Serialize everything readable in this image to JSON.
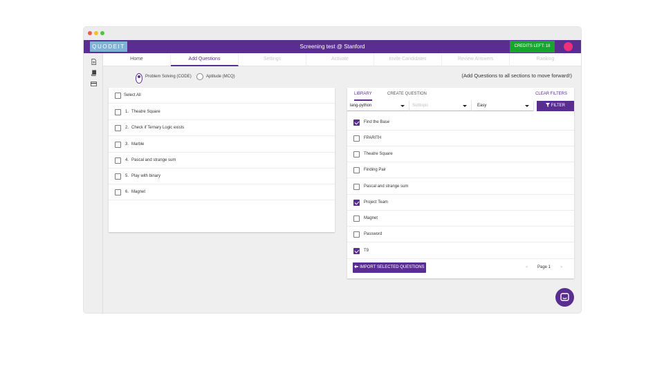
{
  "window": {
    "title": "Screening test @ Stanford"
  },
  "brand": {
    "logo_text": "QUODEIT"
  },
  "header": {
    "credits": "CREDITS LEFT: 18"
  },
  "sidebar": {
    "icons": [
      "document-icon",
      "book-icon",
      "card-icon"
    ]
  },
  "nav": {
    "tabs": [
      {
        "label": "Home",
        "state": "done"
      },
      {
        "label": "Add Questions",
        "state": "active"
      },
      {
        "label": "Settings",
        "state": "disabled"
      },
      {
        "label": "Activate",
        "state": "disabled"
      },
      {
        "label": "Invite Candidates",
        "state": "disabled"
      },
      {
        "label": "Review Answers",
        "state": "disabled"
      },
      {
        "label": "Ranking",
        "state": "disabled"
      }
    ]
  },
  "mode": {
    "options": [
      {
        "label": "Problem Solving (CODE)",
        "selected": true
      },
      {
        "label": "Aptitude (MCQ)",
        "selected": false
      }
    ],
    "hint": "(Add Questions to all sections to move forward!)"
  },
  "selected_panel": {
    "select_all": "Select All",
    "items": [
      {
        "num": "1.",
        "label": "Theatre Square"
      },
      {
        "num": "2.",
        "label": "Check if Ternary Logic exists"
      },
      {
        "num": "3.",
        "label": "Marble"
      },
      {
        "num": "4.",
        "label": "Pascal and strange sum"
      },
      {
        "num": "5.",
        "label": "Play with binary"
      },
      {
        "num": "6.",
        "label": "Magnet"
      }
    ]
  },
  "library": {
    "tabs": {
      "library": "LIBRARY",
      "create": "CREATE QUESTION"
    },
    "clear_filters": "CLEAR FILTERS",
    "filters": {
      "language": "lang-python",
      "subtopic_placeholder": "Subtopic",
      "difficulty": "Easy",
      "button": "FILTER"
    },
    "items": [
      {
        "label": "Find the Base",
        "checked": true
      },
      {
        "label": "FPARITH",
        "checked": false
      },
      {
        "label": "Theatre Square",
        "checked": false
      },
      {
        "label": "Finding Pair",
        "checked": false
      },
      {
        "label": "Pascal and strange sum",
        "checked": false
      },
      {
        "label": "Project Team",
        "checked": true
      },
      {
        "label": "Magnet",
        "checked": false
      },
      {
        "label": "Password",
        "checked": false
      },
      {
        "label": "T9",
        "checked": true
      }
    ],
    "import_button": "IMPORT SELECTED QUESTIONS",
    "pagination": {
      "prev": "«",
      "page": "Page 1",
      "next": "»"
    }
  },
  "colors": {
    "brand": "#5a2d91",
    "credits": "#1aa32e",
    "avatar": "#ee2f7a",
    "logo": "#7fb2d8"
  }
}
